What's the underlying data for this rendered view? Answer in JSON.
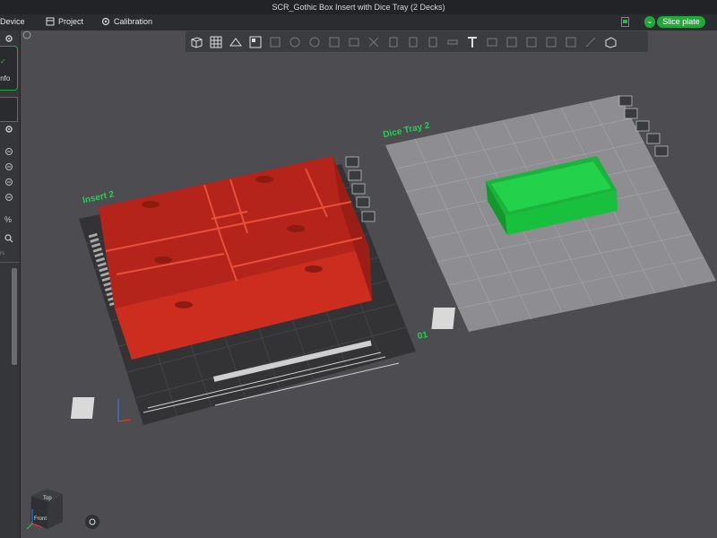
{
  "window": {
    "title": "SCR_Gothic Box Insert with Dice Tray (2 Decks)"
  },
  "menu": {
    "device": "Device",
    "project": "Project",
    "calibration": "Calibration",
    "slice_label": "Slice plate"
  },
  "sidebar": {
    "partial_label_1": "Info",
    "partial_label_2": "rs"
  },
  "plates": {
    "left_label": "Insert 2",
    "right_label": "Dice Tray 2",
    "plate_number": "01"
  },
  "viewcube": {
    "top": "Top",
    "front": "Front"
  },
  "toolbar": {
    "icons": [
      "add-cube-icon",
      "grid-icon",
      "auto-orient-icon",
      "arrange-icon",
      "split-icon",
      "move-icon",
      "rotate-icon",
      "scale-icon",
      "lay-on-face-icon",
      "cut-icon",
      "support-paint-icon",
      "seam-icon",
      "color-paint-icon",
      "measure-icon",
      "text-icon",
      "mesh-boolean-icon",
      "assembly-icon",
      "fit-icon",
      "view-icon",
      "variable-layer-icon",
      "flatten-icon",
      "plate-settings-icon"
    ]
  },
  "colors": {
    "accent": "#20a83a",
    "insert_model": "#c6281a",
    "dice_tray_model": "#1bc23e",
    "viewport_bg": "#4d4d51"
  }
}
